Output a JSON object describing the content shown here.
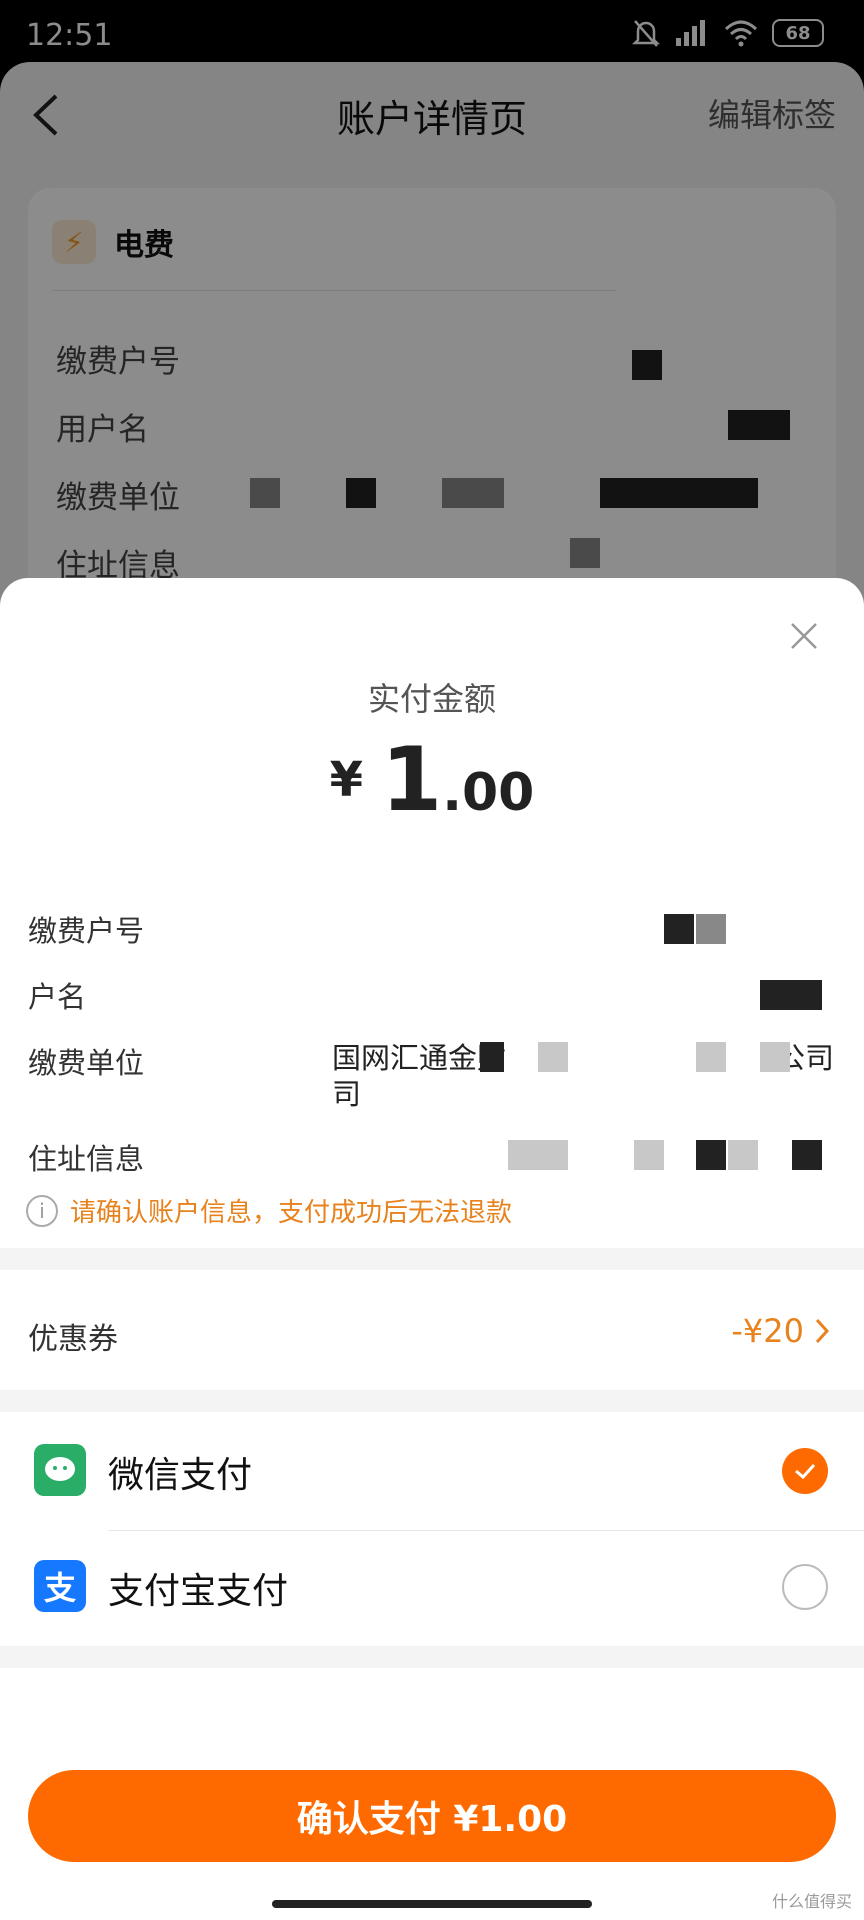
{
  "status_bar": {
    "time": "12:51",
    "battery": "68"
  },
  "background": {
    "title": "账户详情页",
    "edit_label": "编辑标签",
    "card_title": "电费",
    "rows": [
      "缴费户号",
      "用户名",
      "缴费单位",
      "住址信息"
    ]
  },
  "sheet": {
    "pay_label": "实付金额",
    "currency": "¥",
    "amount_int": "1",
    "amount_dec": ".00",
    "rows": {
      "account_no": "缴费户号",
      "name": "户名",
      "unit": "缴费单位",
      "unit_value_line1": "国网汇通金财",
      "unit_value_line1_tail": "公司",
      "unit_value_line2": "司",
      "address": "住址信息"
    },
    "tip": "请确认账户信息，支付成功后无法退款",
    "coupon_label": "优惠券",
    "coupon_value": "-¥20",
    "wechat_label": "微信支付",
    "alipay_label": "支付宝支付",
    "confirm_label": "确认支付 ¥1.00",
    "watermark": "什么值得买"
  },
  "colors": {
    "accent": "#ff6a00",
    "orange_text": "#e8821d",
    "wechat": "#2aae67",
    "alipay": "#1677ff"
  }
}
